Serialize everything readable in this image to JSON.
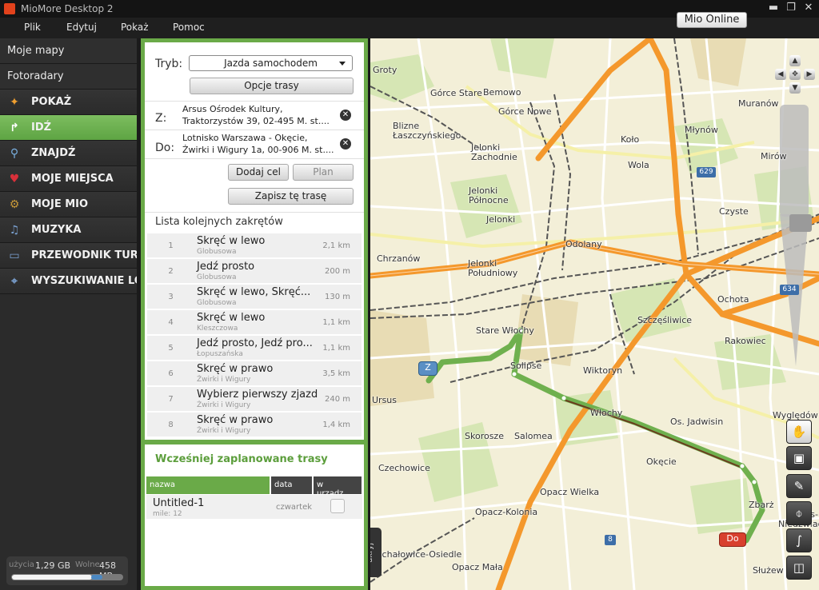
{
  "window": {
    "title": "MioMore Desktop 2",
    "minimize": "▬",
    "maximize": "❐",
    "close": "✕"
  },
  "menu": {
    "items": [
      "Plik",
      "Edytuj",
      "Pokaż",
      "Pomoc"
    ],
    "mio_online": "Mio Online"
  },
  "sidebar": {
    "top_items": [
      "Moje mapy",
      "Fotoradary"
    ],
    "nav": [
      {
        "label": "POKAŻ",
        "icon": "star-icon",
        "glyph": "✦",
        "color": "#f0a030"
      },
      {
        "label": "IDŹ",
        "icon": "route-icon",
        "glyph": "↱",
        "color": "#ffffff",
        "active": true
      },
      {
        "label": "ZNAJDŹ",
        "icon": "magnifier-icon",
        "glyph": "⚲",
        "color": "#7ab0e0"
      },
      {
        "label": "MOJE MIEJSCA",
        "icon": "heart-icon",
        "glyph": "♥",
        "color": "#d8303a"
      },
      {
        "label": "MOJE MIO",
        "icon": "gear-icon",
        "glyph": "⚙",
        "color": "#c89838"
      },
      {
        "label": "MUZYKA",
        "icon": "music-note-icon",
        "glyph": "♫",
        "color": "#7aa0d0"
      },
      {
        "label": "PRZEWODNIK TURYSTYCZNY",
        "icon": "book-icon",
        "glyph": "▭",
        "color": "#7aa0d0"
      },
      {
        "label": "WYSZUKIWANIE LOKALNE",
        "icon": "locate-icon",
        "glyph": "⌖",
        "color": "#7aa0d0"
      }
    ],
    "storage": {
      "used_label": "użycia",
      "used_value": "1,29 GB",
      "free_label": "Wolne",
      "free_value": "458 MB"
    }
  },
  "route": {
    "mode_label": "Tryb:",
    "mode_value": "Jazda samochodem",
    "options_button": "Opcje trasy",
    "from_label": "Z:",
    "from_line1": "Arsus Ośrodek Kultury,",
    "from_line2": "Traktorzystów 39, 02-495 M. st....",
    "to_label": "Do:",
    "to_line1": "Lotnisko Warszawa - Okęcie,",
    "to_line2": "Żwirki i Wigury 1a, 00-906 M. st....",
    "add_goal_button": "Dodaj cel",
    "plan_button": "Plan",
    "save_route_button": "Zapisz tę trasę",
    "turns_title": "Lista kolejnych zakrętów",
    "turns": [
      {
        "n": "1",
        "action": "Skręć w lewo",
        "street": "Globusowa",
        "dist": "2,1 km"
      },
      {
        "n": "2",
        "action": "Jedź prosto",
        "street": "Globusowa",
        "dist": "200 m"
      },
      {
        "n": "3",
        "action": "Skręć w lewo, Skręć...",
        "street": "Globusowa",
        "dist": "130 m"
      },
      {
        "n": "4",
        "action": "Skręć w lewo",
        "street": "Kleszczowa",
        "dist": "1,1 km"
      },
      {
        "n": "5",
        "action": "Jedź prosto, Jedź pro...",
        "street": "Łopuszańska",
        "dist": "1,1 km"
      },
      {
        "n": "6",
        "action": "Skręć w prawo",
        "street": "Żwirki i Wigury",
        "dist": "3,5 km"
      },
      {
        "n": "7",
        "action": "Wybierz pierwszy zjazd",
        "street": "Żwirki i Wigury",
        "dist": "240 m"
      },
      {
        "n": "8",
        "action": "Skręć w prawo",
        "street": "Żwirki i Wigury",
        "dist": "1,4 km"
      }
    ]
  },
  "planned": {
    "title": "Wcześniej zaplanowane trasy",
    "columns": [
      "nazwa",
      "data",
      "w urządz..."
    ],
    "rows": [
      {
        "name": "Untitled-1",
        "sub": "mile: 12",
        "date": "czwartek"
      }
    ]
  },
  "map": {
    "hide_tab": "ukryj",
    "start_marker": "Z",
    "end_marker": "Do",
    "shields": [
      "629",
      "634",
      "8"
    ],
    "labels": [
      "Groty",
      "Górce Stare",
      "Bemowo",
      "Górce Nowe",
      "Blizne Łaszczyńskiego",
      "Jelonki Zachodnie",
      "Koło",
      "Wola",
      "Młynów",
      "Muranów",
      "Mirów",
      "Jelonki Północne",
      "Jelonki",
      "Czyste",
      "Chrzanów",
      "Odolany",
      "Jelonki Południowy",
      "Ochota",
      "Szczęśliwice",
      "Stare Włochy",
      "Rakowiec",
      "Solipse",
      "Wiktoryn",
      "Ursus",
      "Włochy",
      "Os. Jadwisin",
      "Wyględów",
      "Skorosze",
      "Salomea",
      "Okęcie",
      "Czechowice",
      "Opacz Wielka",
      "Zbarż",
      "Opacz-Kolonia",
      "Ursus-Niedźwiadek",
      "Michałowice-Osiedle",
      "Opacz Mała",
      "Służew"
    ],
    "tools": [
      "hand-icon",
      "camera-icon",
      "pin-tool-icon",
      "microphone-icon",
      "route-tool-icon",
      "speed-camera-icon"
    ]
  }
}
